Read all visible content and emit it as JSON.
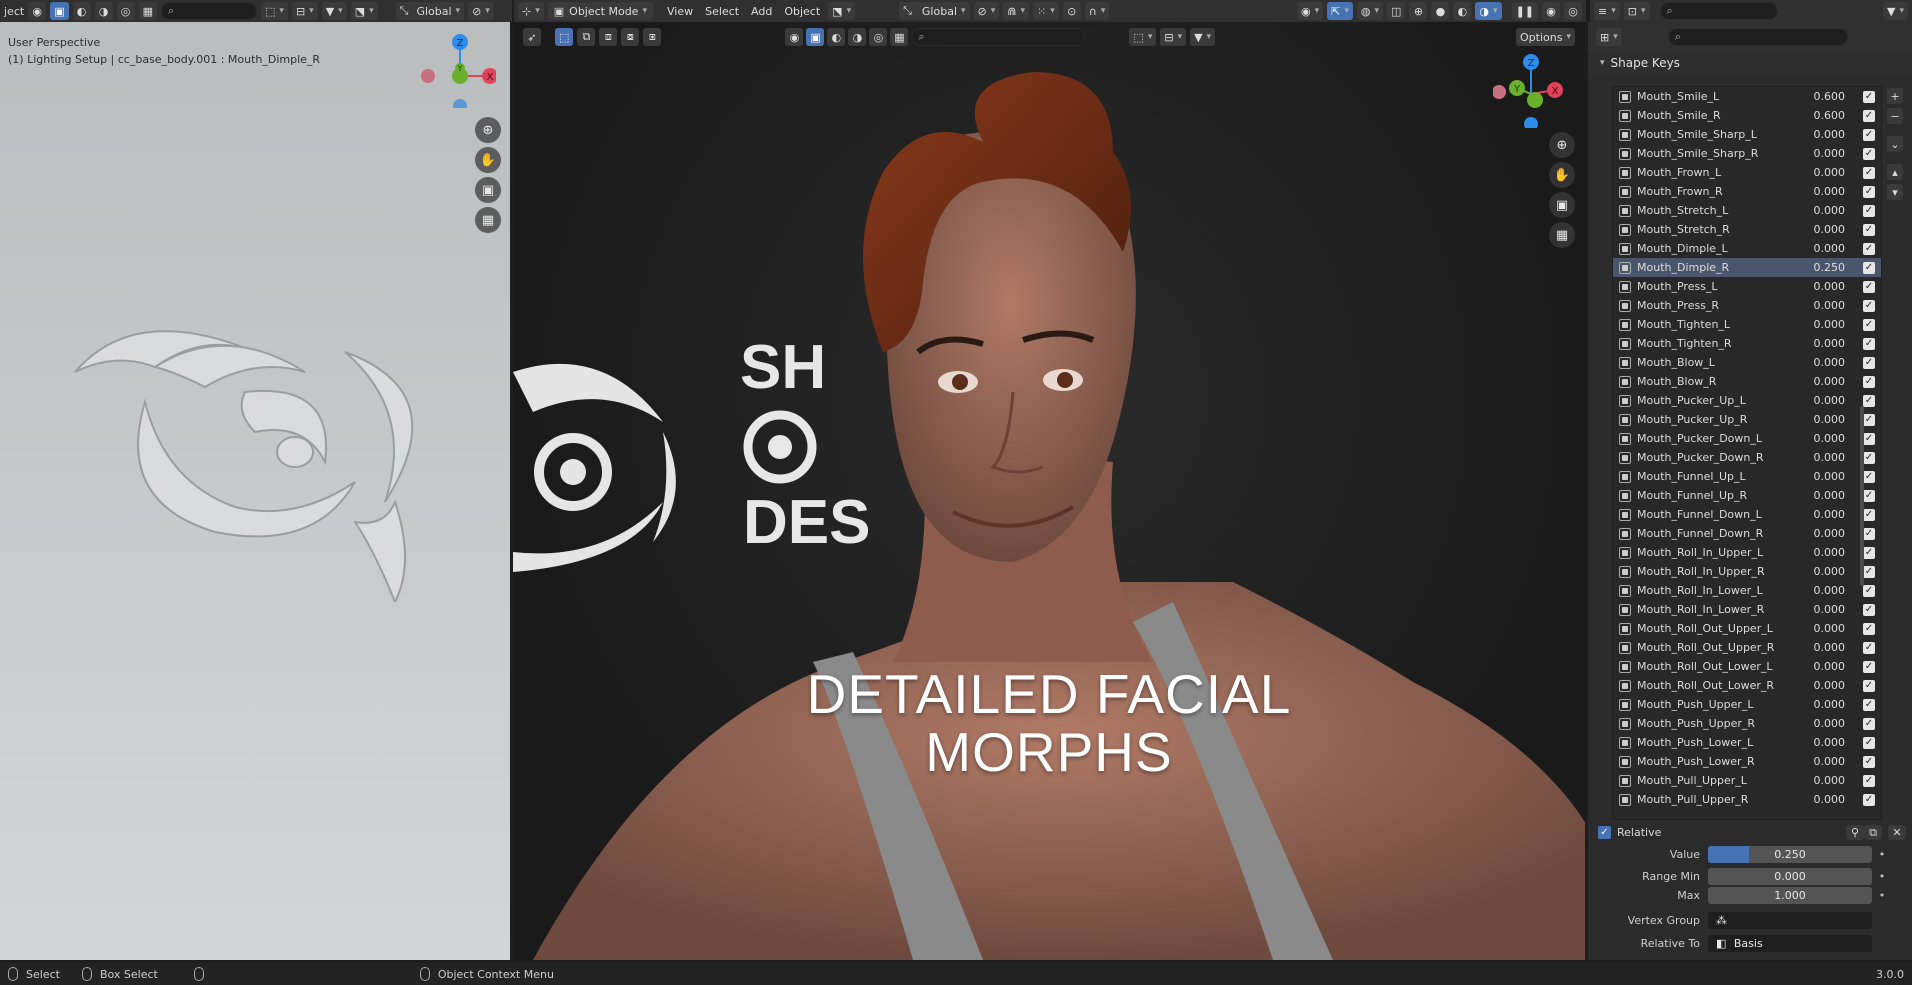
{
  "left_header": {
    "menu_label": "ject",
    "search_placeholder": "",
    "orientation": "Global"
  },
  "left_viewport": {
    "view_name": "User Perspective",
    "object_info": "(1) Lighting Setup | cc_base_body.001 : Mouth_Dimple_R"
  },
  "mid_header": {
    "mode": "Object Mode",
    "menus": [
      "View",
      "Select",
      "Add",
      "Object"
    ],
    "orientation": "Global",
    "options_label": "Options"
  },
  "viewport_caption": {
    "line1": "DETAILED FACIAL",
    "line2": "MORPHS"
  },
  "logo_text": {
    "line1": "SH",
    "line3": "DES"
  },
  "gizmo_axes": {
    "x": "X",
    "y": "Y",
    "z": "Z"
  },
  "right_panel": {
    "section_title": "Shape Keys",
    "shape_keys": [
      {
        "name": "Mouth_Smile_L",
        "value": "0.600"
      },
      {
        "name": "Mouth_Smile_R",
        "value": "0.600"
      },
      {
        "name": "Mouth_Smile_Sharp_L",
        "value": "0.000"
      },
      {
        "name": "Mouth_Smile_Sharp_R",
        "value": "0.000"
      },
      {
        "name": "Mouth_Frown_L",
        "value": "0.000"
      },
      {
        "name": "Mouth_Frown_R",
        "value": "0.000"
      },
      {
        "name": "Mouth_Stretch_L",
        "value": "0.000"
      },
      {
        "name": "Mouth_Stretch_R",
        "value": "0.000"
      },
      {
        "name": "Mouth_Dimple_L",
        "value": "0.000"
      },
      {
        "name": "Mouth_Dimple_R",
        "value": "0.250"
      },
      {
        "name": "Mouth_Press_L",
        "value": "0.000"
      },
      {
        "name": "Mouth_Press_R",
        "value": "0.000"
      },
      {
        "name": "Mouth_Tighten_L",
        "value": "0.000"
      },
      {
        "name": "Mouth_Tighten_R",
        "value": "0.000"
      },
      {
        "name": "Mouth_Blow_L",
        "value": "0.000"
      },
      {
        "name": "Mouth_Blow_R",
        "value": "0.000"
      },
      {
        "name": "Mouth_Pucker_Up_L",
        "value": "0.000"
      },
      {
        "name": "Mouth_Pucker_Up_R",
        "value": "0.000"
      },
      {
        "name": "Mouth_Pucker_Down_L",
        "value": "0.000"
      },
      {
        "name": "Mouth_Pucker_Down_R",
        "value": "0.000"
      },
      {
        "name": "Mouth_Funnel_Up_L",
        "value": "0.000"
      },
      {
        "name": "Mouth_Funnel_Up_R",
        "value": "0.000"
      },
      {
        "name": "Mouth_Funnel_Down_L",
        "value": "0.000"
      },
      {
        "name": "Mouth_Funnel_Down_R",
        "value": "0.000"
      },
      {
        "name": "Mouth_Roll_In_Upper_L",
        "value": "0.000"
      },
      {
        "name": "Mouth_Roll_In_Upper_R",
        "value": "0.000"
      },
      {
        "name": "Mouth_Roll_In_Lower_L",
        "value": "0.000"
      },
      {
        "name": "Mouth_Roll_In_Lower_R",
        "value": "0.000"
      },
      {
        "name": "Mouth_Roll_Out_Upper_L",
        "value": "0.000"
      },
      {
        "name": "Mouth_Roll_Out_Upper_R",
        "value": "0.000"
      },
      {
        "name": "Mouth_Roll_Out_Lower_L",
        "value": "0.000"
      },
      {
        "name": "Mouth_Roll_Out_Lower_R",
        "value": "0.000"
      },
      {
        "name": "Mouth_Push_Upper_L",
        "value": "0.000"
      },
      {
        "name": "Mouth_Push_Upper_R",
        "value": "0.000"
      },
      {
        "name": "Mouth_Push_Lower_L",
        "value": "0.000"
      },
      {
        "name": "Mouth_Push_Lower_R",
        "value": "0.000"
      },
      {
        "name": "Mouth_Pull_Upper_L",
        "value": "0.000"
      },
      {
        "name": "Mouth_Pull_Upper_R",
        "value": "0.000"
      }
    ],
    "selected_key": "Mouth_Dimple_R",
    "relative_label": "Relative",
    "value_label": "Value",
    "value": "0.250",
    "value_fraction": 0.25,
    "range_min_label": "Range Min",
    "range_min": "0.000",
    "max_label": "Max",
    "max": "1.000",
    "vertex_group_label": "Vertex Group",
    "vertex_group": "",
    "relative_to_label": "Relative To",
    "relative_to": "Basis"
  },
  "statusbar": {
    "select": "Select",
    "box_select": "Box Select",
    "context_menu": "Object Context Menu",
    "version": "3.0.0"
  },
  "colors": {
    "accent": "#4772b3",
    "axis_x": "#e0445a",
    "axis_y": "#6ab02c",
    "axis_z": "#2d8ceb"
  }
}
